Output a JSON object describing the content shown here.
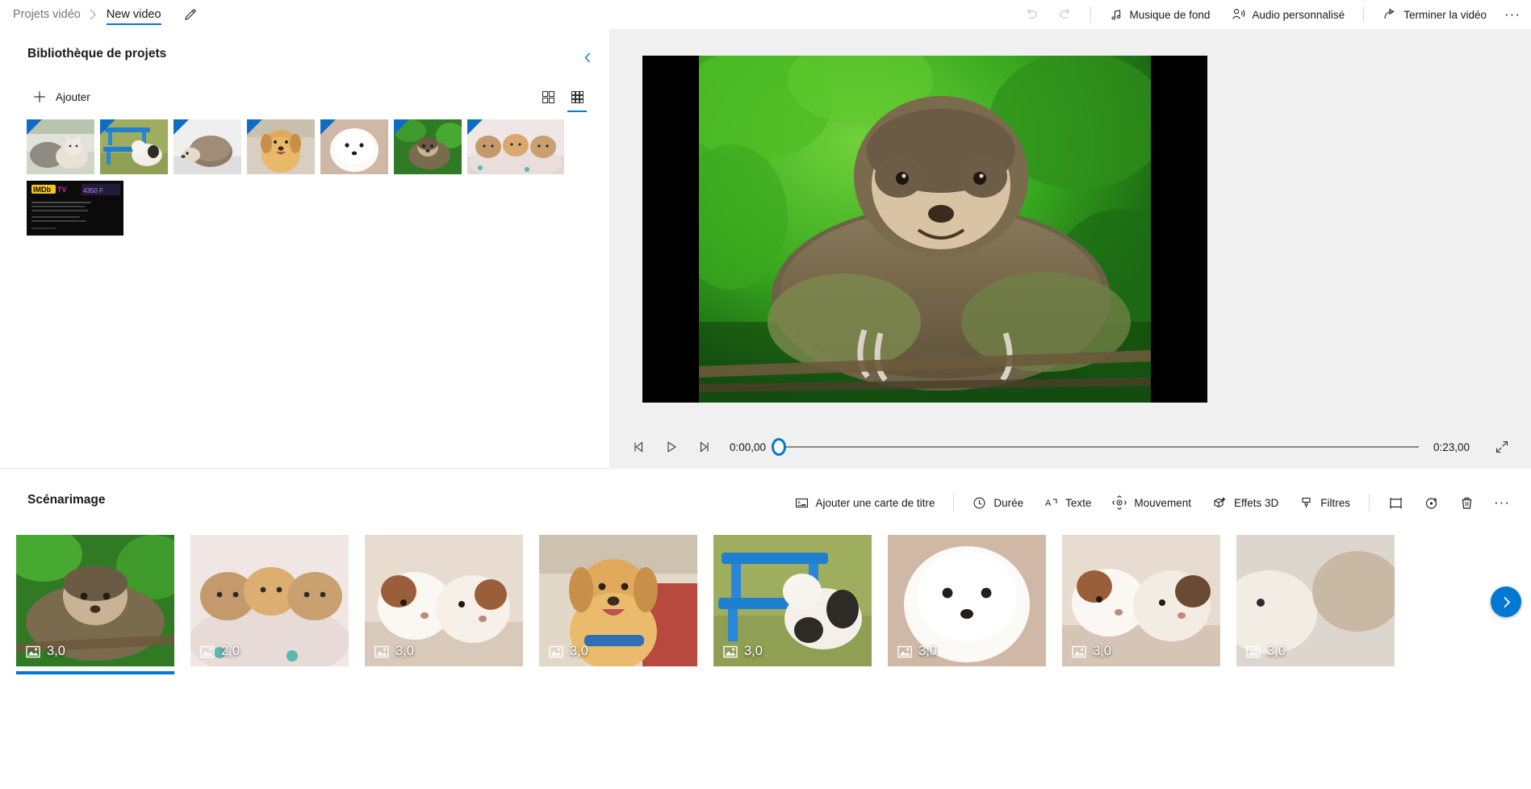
{
  "breadcrumb": {
    "root_label": "Projets vidéo",
    "separator": "›",
    "current_label": "New video",
    "rename_icon": "pencil-icon"
  },
  "topbar": {
    "undo_icon": "undo-icon",
    "redo_icon": "redo-icon",
    "background_music_label": "Musique de fond",
    "background_music_icon": "music-note-icon",
    "custom_audio_label": "Audio personnalisé",
    "custom_audio_icon": "person-audio-icon",
    "finish_video_label": "Terminer la vidéo",
    "finish_video_icon": "share-icon",
    "more_label": "···"
  },
  "library": {
    "title": "Bibliothèque de projets",
    "collapse_icon": "chevron-left-icon",
    "add_label": "Ajouter",
    "add_icon": "plus-icon",
    "view_large_icon": "grid-large-icon",
    "view_small_icon": "grid-small-icon",
    "active_view": "grid-small",
    "items": [
      {
        "name": "cat-and-kitten",
        "type": "image"
      },
      {
        "name": "puppy-picnic-table",
        "type": "image"
      },
      {
        "name": "hedgehog",
        "type": "image"
      },
      {
        "name": "golden-retriever-puppy",
        "type": "image"
      },
      {
        "name": "white-pomeranian",
        "type": "image"
      },
      {
        "name": "sloth",
        "type": "image"
      },
      {
        "name": "three-kittens",
        "type": "image"
      },
      {
        "name": "imdb-tv-card",
        "type": "video",
        "brand_primary": "IMDb",
        "brand_secondary": "TV",
        "body_text": "IMDb TV is a ad supported customers in the U.S. at this time. Check out our guide to what else is on TV and streaming for you."
      }
    ]
  },
  "preview": {
    "current_frame": "sloth-in-green-foliage",
    "prev_frame_icon": "previous-frame-icon",
    "play_icon": "play-icon",
    "next_frame_icon": "next-frame-icon",
    "current_time": "0:00,00",
    "total_time": "0:23,00",
    "progress_percent": 0,
    "expand_icon": "fullscreen-icon"
  },
  "storyboard": {
    "title": "Scénarimage",
    "tools": [
      {
        "label": "Ajouter une carte de titre",
        "icon": "title-card-icon"
      },
      {
        "label": "Durée",
        "icon": "clock-icon"
      },
      {
        "label": "Texte",
        "icon": "text-icon"
      },
      {
        "label": "Mouvement",
        "icon": "motion-icon"
      },
      {
        "label": "Effets 3D",
        "icon": "cube-sparkle-icon"
      },
      {
        "label": "Filtres",
        "icon": "filter-brush-icon"
      }
    ],
    "icon_buttons": [
      {
        "name": "crop-icon"
      },
      {
        "name": "rotate-icon"
      },
      {
        "name": "delete-icon"
      },
      {
        "name": "more-options-icon"
      }
    ],
    "duration_icon": "image-icon",
    "next_icon": "chevron-right-icon",
    "clips": [
      {
        "name": "sloth",
        "duration": "3,0",
        "selected": true
      },
      {
        "name": "three-kittens",
        "duration": "2,0",
        "selected": false
      },
      {
        "name": "two-guinea-pigs",
        "duration": "3,0",
        "selected": false
      },
      {
        "name": "golden-retriever-puppy",
        "duration": "3,0",
        "selected": false
      },
      {
        "name": "puppy-picnic-table",
        "duration": "3,0",
        "selected": false
      },
      {
        "name": "white-pomeranian",
        "duration": "3,0",
        "selected": false
      },
      {
        "name": "guinea-pig-pair",
        "duration": "3,0",
        "selected": false
      },
      {
        "name": "kitten-partial",
        "duration": "3,0",
        "selected": false
      }
    ]
  },
  "colors": {
    "accent": "#0078d4",
    "panel_bg": "#f0f0f0",
    "text": "#1a1a1a",
    "muted": "#767676"
  }
}
